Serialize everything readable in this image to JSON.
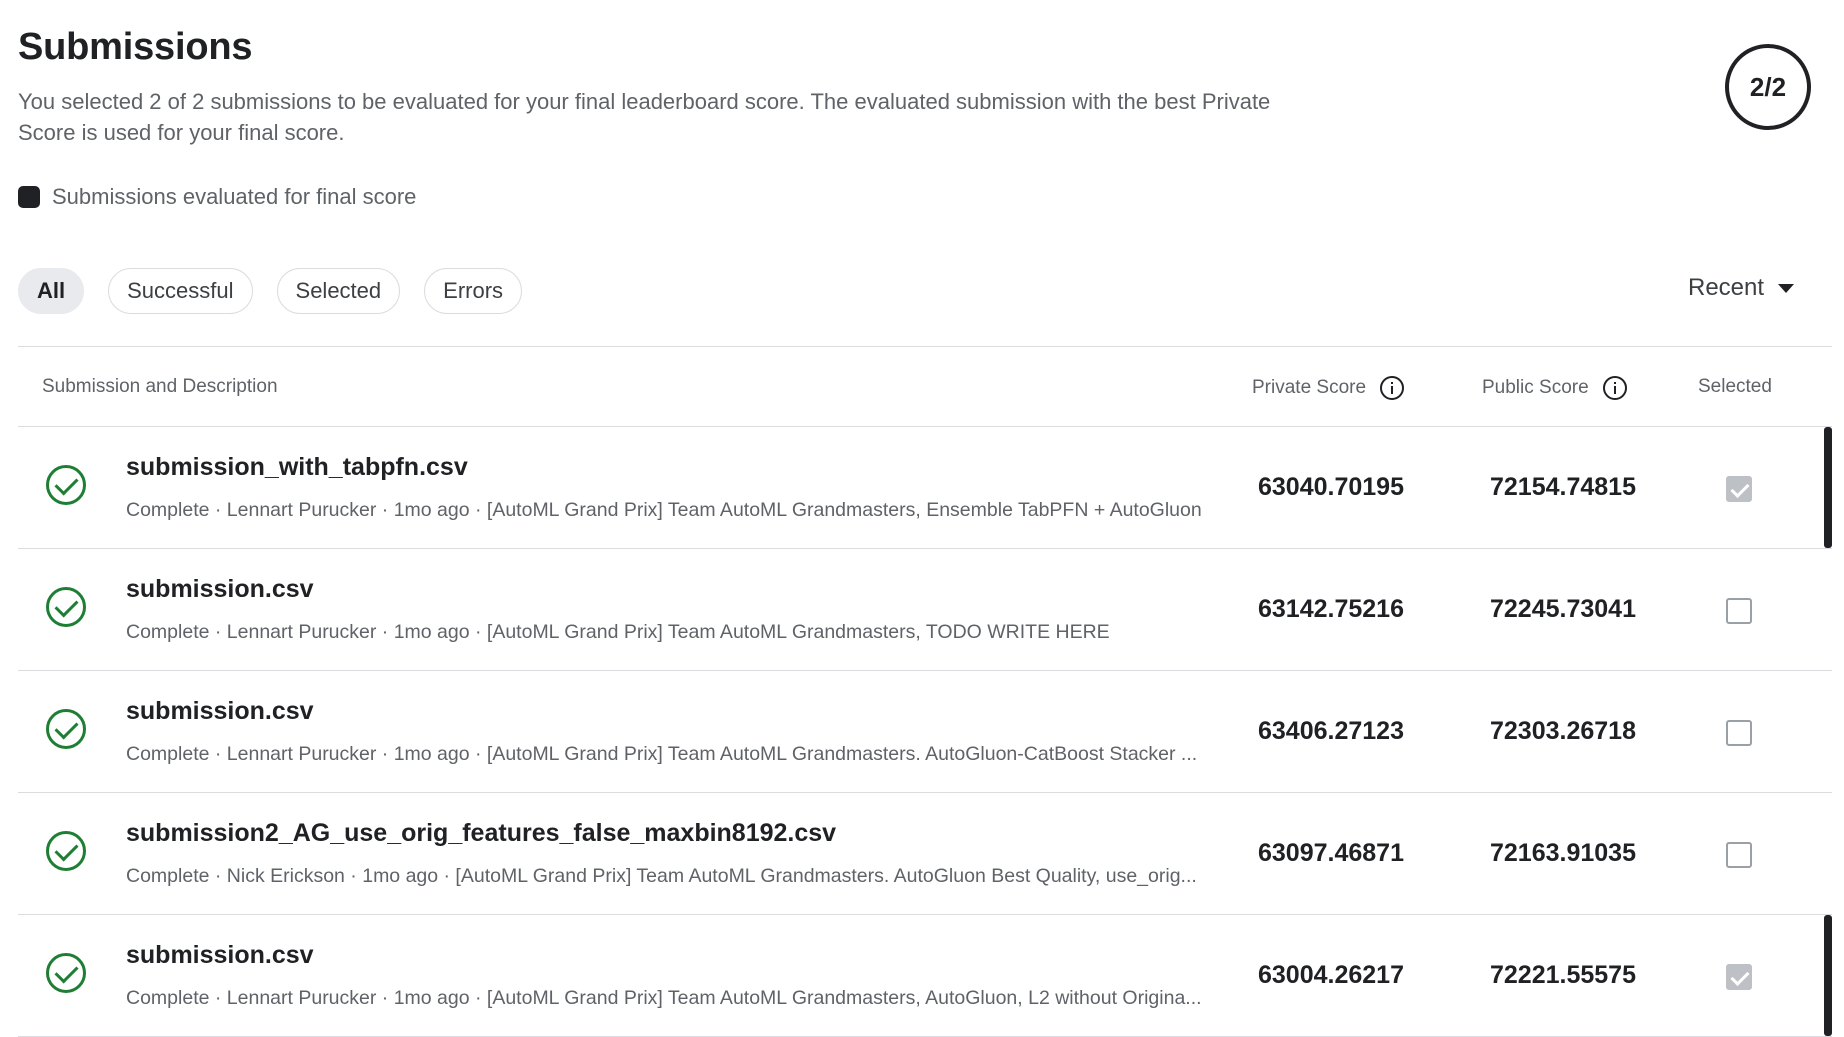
{
  "header": {
    "title": "Submissions",
    "description": "You selected 2 of 2 submissions to be evaluated for your final leaderboard score. The evaluated submission with the best Private Score is used for your final score.",
    "counter": "2/2",
    "legend_label": "Submissions evaluated for final score"
  },
  "filters": {
    "all": "All",
    "successful": "Successful",
    "selected": "Selected",
    "errors": "Errors",
    "active": "All"
  },
  "sort": {
    "label": "Recent"
  },
  "table": {
    "headers": {
      "submission": "Submission and Description",
      "private": "Private Score",
      "public": "Public Score",
      "selected": "Selected"
    },
    "rows": [
      {
        "file": "submission_with_tabpfn.csv",
        "meta": "Complete · Lennart Purucker · 1mo ago · [AutoML Grand Prix] Team AutoML Grandmasters, Ensemble TabPFN + AutoGluon",
        "private": "63040.70195",
        "public": "72154.74815",
        "selected": true
      },
      {
        "file": "submission.csv",
        "meta": "Complete · Lennart Purucker · 1mo ago · [AutoML Grand Prix] Team AutoML Grandmasters, TODO WRITE HERE",
        "private": "63142.75216",
        "public": "72245.73041",
        "selected": false
      },
      {
        "file": "submission.csv",
        "meta": "Complete · Lennart Purucker · 1mo ago · [AutoML Grand Prix] Team AutoML Grandmasters. AutoGluon-CatBoost Stacker ...",
        "private": "63406.27123",
        "public": "72303.26718",
        "selected": false
      },
      {
        "file": "submission2_AG_use_orig_features_false_maxbin8192.csv",
        "meta": "Complete · Nick Erickson · 1mo ago · [AutoML Grand Prix] Team AutoML Grandmasters. AutoGluon Best Quality, use_orig...",
        "private": "63097.46871",
        "public": "72163.91035",
        "selected": false
      },
      {
        "file": "submission.csv",
        "meta": "Complete · Lennart Purucker · 1mo ago · [AutoML Grand Prix] Team AutoML Grandmasters, AutoGluon, L2 without Origina...",
        "private": "63004.26217",
        "public": "72221.55575",
        "selected": true
      }
    ]
  },
  "icons": {
    "status": "check-circle-icon",
    "info": "info-icon",
    "sort": "caret-down-icon"
  },
  "colors": {
    "success": "#1e7e34",
    "selected_bar": "#202124"
  }
}
